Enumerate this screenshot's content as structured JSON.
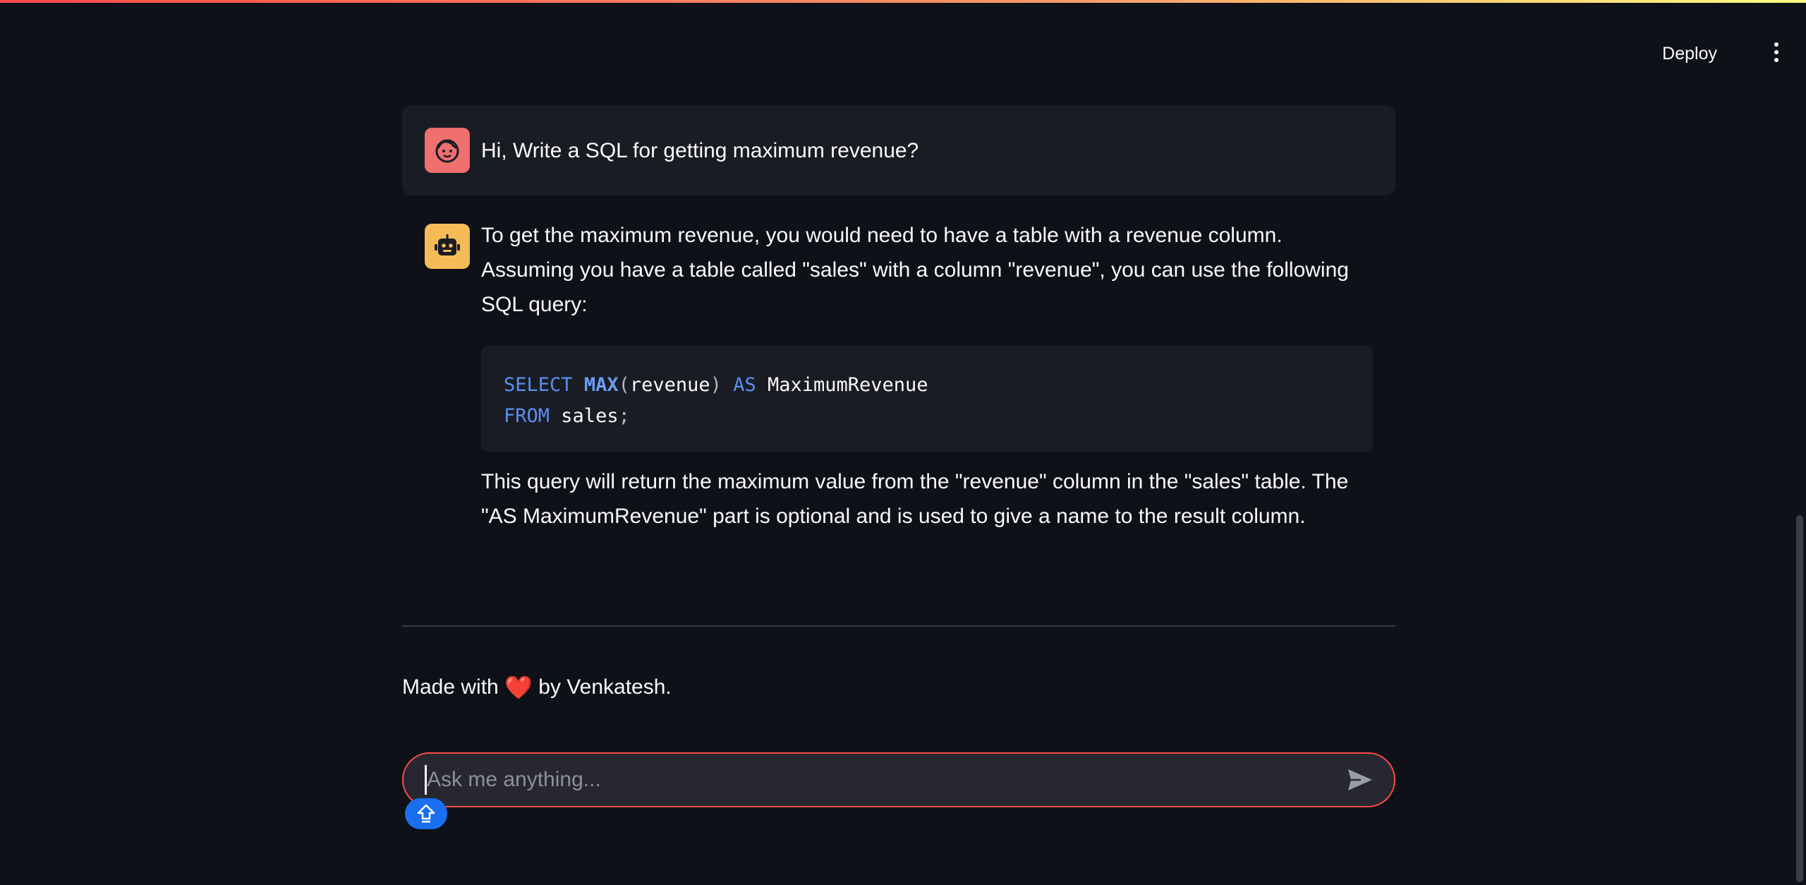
{
  "header": {
    "deploy_label": "Deploy",
    "menu_icon": "vertical-ellipsis-icon"
  },
  "messages": {
    "user": {
      "avatar_icon": "user-face-icon",
      "text": "Hi, Write a SQL for getting maximum revenue?"
    },
    "assistant": {
      "avatar_icon": "robot-icon",
      "intro": "To get the maximum revenue, you would need to have a table with a revenue column. Assuming you have a table called \"sales\" with a column \"revenue\", you can use the following SQL query:",
      "code": {
        "line1": {
          "kw1": "SELECT",
          "fn": "MAX",
          "open": "(",
          "arg": "revenue",
          "close": ")",
          "kw2": "AS",
          "alias": "MaximumRevenue"
        },
        "line2": {
          "kw": "FROM",
          "table": "sales",
          "end": ";"
        }
      },
      "outro": "This query will return the maximum value from the \"revenue\" column in the \"sales\" table. The \"AS MaximumRevenue\" part is optional and is used to give a name to the result column."
    }
  },
  "footer": {
    "prefix": "Made with",
    "heart": "❤️",
    "suffix": "by Venkatesh."
  },
  "chat_input": {
    "placeholder": "Ask me anything...",
    "send_icon": "send-icon"
  },
  "badge_icon": "upload-arrow-icon",
  "colors": {
    "background": "#0e1117",
    "accent": "#ff4b4b",
    "user_avatar": "#f06f6f",
    "bot_avatar": "#f5bb56",
    "keyword": "#5a8ff0"
  }
}
